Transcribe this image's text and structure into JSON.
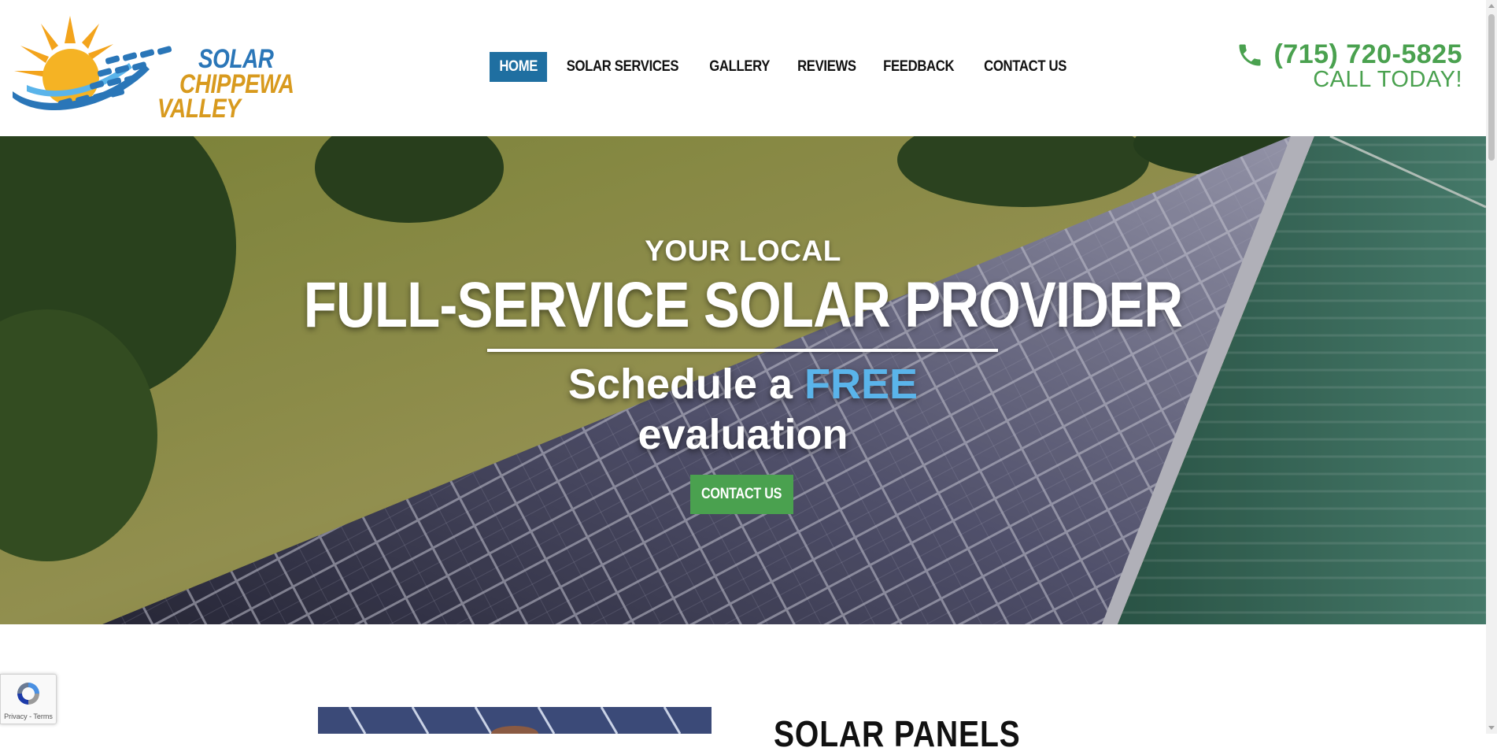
{
  "header": {
    "logo": {
      "line1": "SOLAR",
      "line2": "CHIPPEWA",
      "line3": "VALLEY",
      "colors": {
        "blue": "#2a76b8",
        "gold": "#d89a1e",
        "sun": "#f3a41c"
      }
    },
    "nav": [
      {
        "label": "HOME",
        "active": true
      },
      {
        "label": "SOLAR SERVICES",
        "active": false
      },
      {
        "label": "GALLERY",
        "active": false
      },
      {
        "label": "REVIEWS",
        "active": false
      },
      {
        "label": "FEEDBACK",
        "active": false
      },
      {
        "label": "CONTACT US",
        "active": false
      }
    ],
    "phone": {
      "icon": "phone-icon",
      "number": "(715) 720-5825",
      "cta": "CALL TODAY!"
    }
  },
  "hero": {
    "eyebrow": "YOUR LOCAL",
    "title": "FULL-SERVICE SOLAR PROVIDER",
    "subtitle_part1": "Schedule a ",
    "subtitle_accent": "FREE",
    "subtitle_part2": "evaluation",
    "button_label": "CONTACT US"
  },
  "section": {
    "heading": "SOLAR PANELS"
  },
  "recaptcha": {
    "links": "Privacy - Terms"
  },
  "colors": {
    "nav_active": "#1f6fa1",
    "green": "#4aa14f",
    "accent_blue": "#5ab4ea"
  }
}
